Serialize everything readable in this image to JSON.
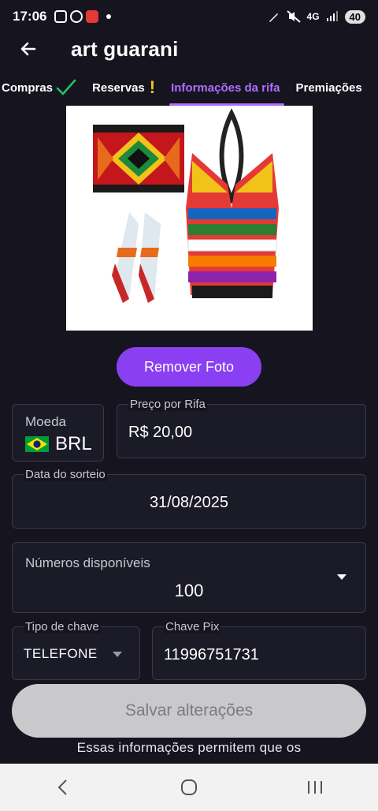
{
  "status_bar": {
    "time": "17:06",
    "network": "4G",
    "battery": "40"
  },
  "app_bar": {
    "title": "art guarani",
    "back_icon": "arrow-left-icon"
  },
  "tabs": [
    {
      "label": "Compras",
      "indicator": "check-icon",
      "active": false
    },
    {
      "label": "Reservas",
      "indicator": "exclamation-icon",
      "active": false
    },
    {
      "label": "Informações da rifa",
      "indicator": "",
      "active": true
    },
    {
      "label": "Premiações",
      "indicator": "",
      "active": false
    }
  ],
  "form": {
    "remove_photo_label": "Remover Foto",
    "currency": {
      "label": "Moeda",
      "value": "BRL",
      "flag": "brazil-flag-icon"
    },
    "price": {
      "label": "Preço por Rifa",
      "value": "R$ 20,00"
    },
    "draw_date": {
      "label": "Data do sorteio",
      "value": "31/08/2025"
    },
    "numbers": {
      "label": "Números disponíveis",
      "value": "100"
    },
    "key_type": {
      "label": "Tipo de chave",
      "value": "TELEFONE"
    },
    "pix_key": {
      "label": "Chave Pix",
      "value": "11996751731"
    },
    "save_label": "Salvar alterações",
    "info_text": "Essas informações permitem que os"
  },
  "colors": {
    "background": "#15141f",
    "accent": "#8b3ff2",
    "active_tab": "#b06cff",
    "check": "#22c55e",
    "warning": "#f5c518"
  }
}
